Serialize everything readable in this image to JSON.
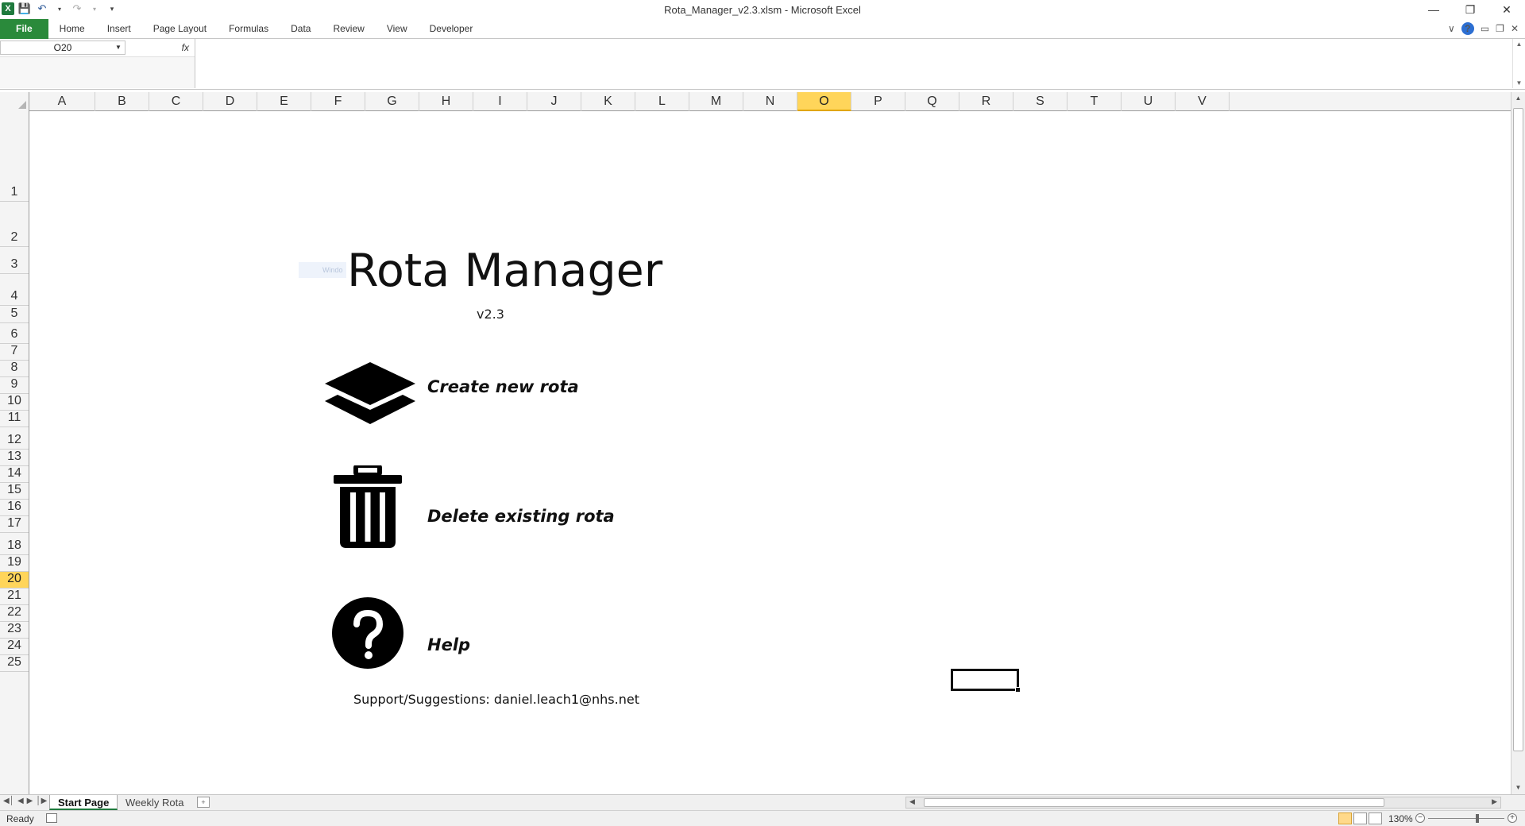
{
  "window": {
    "title": "Rota_Manager_v2.3.xlsm  -  Microsoft Excel"
  },
  "ribbon": {
    "tabs": [
      "File",
      "Home",
      "Insert",
      "Page Layout",
      "Formulas",
      "Data",
      "Review",
      "View",
      "Developer"
    ]
  },
  "formula_bar": {
    "name_box": "O20",
    "fx_symbol": "fx",
    "formula": ""
  },
  "columns": [
    "A",
    "B",
    "C",
    "D",
    "E",
    "F",
    "G",
    "H",
    "I",
    "J",
    "K",
    "L",
    "M",
    "N",
    "O",
    "P",
    "Q",
    "R",
    "S",
    "T",
    "U",
    "V"
  ],
  "selected_column": "O",
  "rows": [
    "1",
    "2",
    "3",
    "4",
    "5",
    "6",
    "7",
    "8",
    "9",
    "10",
    "11",
    "12",
    "13",
    "14",
    "15",
    "16",
    "17",
    "18",
    "19",
    "20",
    "21",
    "22",
    "23",
    "24",
    "25"
  ],
  "selected_row": "20",
  "content": {
    "title": "Rota Manager",
    "version": "v2.3",
    "create_label": "Create new rota",
    "delete_label": "Delete existing rota",
    "help_label": "Help",
    "support": "Support/Suggestions: daniel.leach1@nhs.net",
    "watermark": "Windo"
  },
  "sheet_tabs": [
    "Start Page",
    "Weekly Rota"
  ],
  "active_sheet": "Start Page",
  "status": {
    "ready": "Ready",
    "zoom": "130%"
  },
  "icons": {
    "create": "layers-icon",
    "delete": "trash-icon",
    "help": "question-circle-icon"
  }
}
